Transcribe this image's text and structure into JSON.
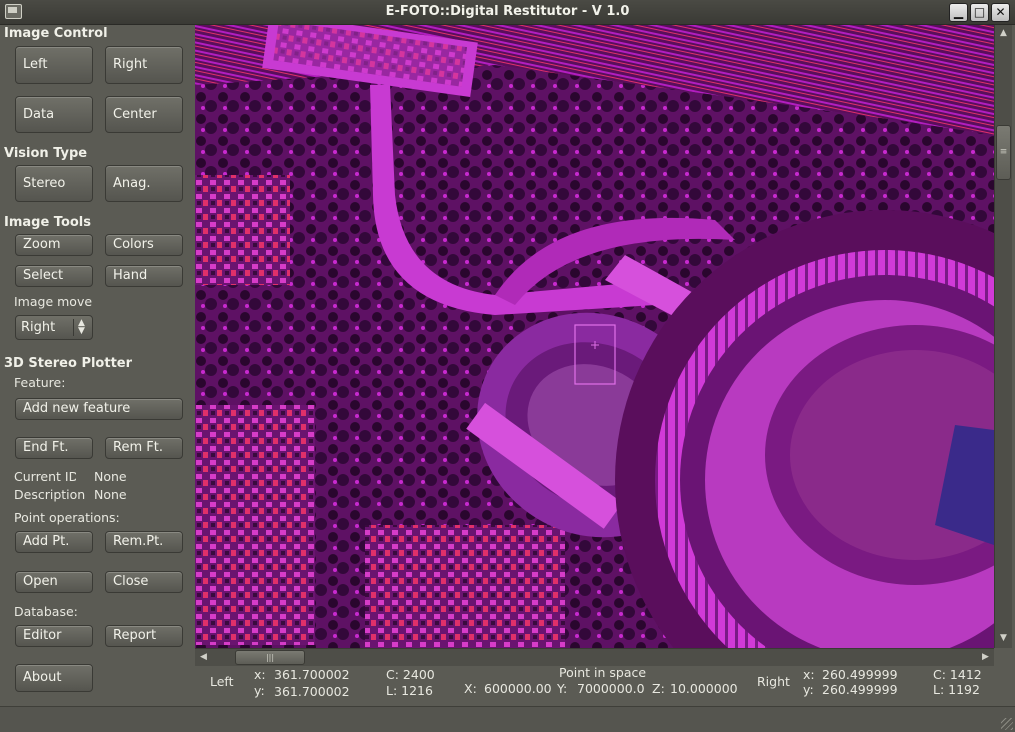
{
  "window": {
    "title": "E-FOTO::Digital Restitutor - V 1.0",
    "min_glyph": "▁",
    "max_glyph": "□",
    "close_glyph": "✕"
  },
  "image_control": {
    "heading": "Image Control",
    "left": "Left",
    "right": "Right",
    "data": "Data",
    "center": "Center"
  },
  "vision_type": {
    "heading": "Vision Type",
    "stereo": "Stereo",
    "anag": "Anag."
  },
  "image_tools": {
    "heading": "Image Tools",
    "zoom": "Zoom",
    "colors": "Colors",
    "select": "Select",
    "hand": "Hand",
    "image_move_label": "Image move",
    "image_move_value": "Right"
  },
  "plotter": {
    "heading": "3D Stereo Plotter",
    "feature_label": "Feature:",
    "add_new_feature": "Add new feature",
    "end_ft": "End Ft.",
    "rem_ft": "Rem Ft.",
    "current_id_label": "Current ID",
    "current_id_value": "None",
    "description_label": "Description",
    "description_value": "None",
    "point_ops_label": "Point operations:",
    "add_pt": "Add Pt.",
    "rem_pt": "Rem.Pt.",
    "open": "Open",
    "close": "Close",
    "database_label": "Database:",
    "editor": "Editor",
    "report": "Report",
    "about": "About"
  },
  "status": {
    "left_label": "Left",
    "left_x_label": "x:",
    "left_x": "361.700002",
    "left_y_label": "y:",
    "left_y": "361.700002",
    "left_c": "C: 2400",
    "left_l": "L: 1216",
    "point_in_space": "Point in space",
    "X_label": "X:",
    "X": "600000.00",
    "Y_label": "Y:",
    "Y": "7000000.0",
    "Z_label": "Z:",
    "Z": "10.000000",
    "right_label": "Right",
    "right_x_label": "x:",
    "right_x": "260.499999",
    "right_y_label": "y:",
    "right_y": "260.499999",
    "right_c": "C: 1412",
    "right_l": "L: 1192"
  },
  "scroll": {
    "up": "▲",
    "down": "▼",
    "left": "◀",
    "right": "▶",
    "h_grip": "|||",
    "v_grip": "≡"
  },
  "colors": {
    "image_base": "#4b0b4a",
    "magenta": "#c21fd0",
    "red": "#e0306a",
    "cursor": "#e070e8"
  }
}
